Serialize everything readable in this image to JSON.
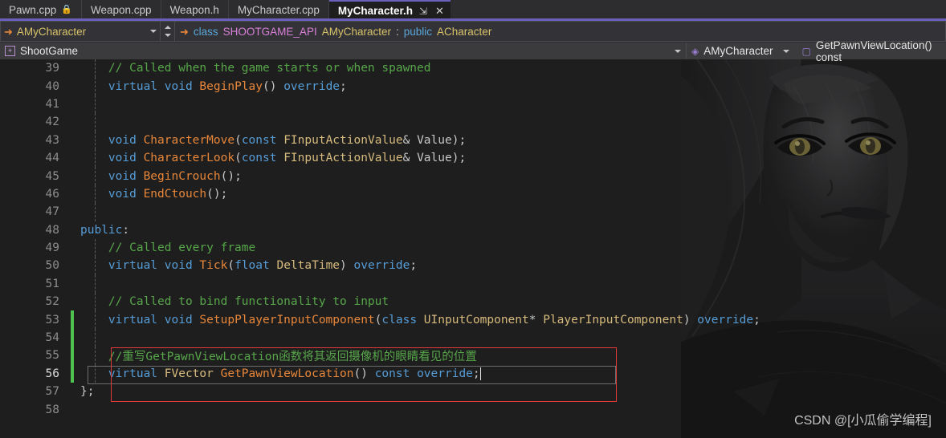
{
  "tabs": [
    {
      "label": "Pawn.cpp",
      "icon": "lock-icon",
      "active": false,
      "pinned": false,
      "closable": false
    },
    {
      "label": "Weapon.cpp",
      "icon": "",
      "active": false,
      "pinned": false,
      "closable": false
    },
    {
      "label": "Weapon.h",
      "icon": "",
      "active": false,
      "pinned": false,
      "closable": false
    },
    {
      "label": "MyCharacter.cpp",
      "icon": "",
      "active": false,
      "pinned": false,
      "closable": false
    },
    {
      "label": "MyCharacter.h",
      "icon": "",
      "active": true,
      "pinned": true,
      "closable": true
    }
  ],
  "tab_icons": {
    "lock": "\u0001f512",
    "pin": "↯",
    "close": "✕"
  },
  "navbar": {
    "class_combo_value": "AMyCharacter",
    "class_combo_icon": "right-arrow-icon",
    "signature_icon": "right-arrow-icon",
    "signature": {
      "kw_class": "class",
      "macro": "SHOOTGAME_API",
      "type": "AMyCharacter",
      "colon": ":",
      "kw_public": "public",
      "base": "ACharacter"
    },
    "project_value": "ShootGame",
    "project_icon": "project-icon",
    "scope_value": "AMyCharacter",
    "scope_icon": "class-icon",
    "member_value": "GetPawnViewLocation() const",
    "member_icon": "method-icon"
  },
  "accent_colors": {
    "tab_underline": "#6a5fbb",
    "annotation_box": "#e03a3a",
    "change_bar": "#4ec14e",
    "comment": "#57a64a",
    "keyword": "#569cd6",
    "type": "#d7ba7d",
    "function": "#e8873a",
    "editor_bg": "#1e1e1e"
  },
  "editor": {
    "current_line": 56,
    "lines": [
      {
        "n": "39",
        "changed": false,
        "indent": true,
        "tokens": [
          {
            "t": "    ",
            "c": "t-plain"
          },
          {
            "t": "// Called when the game starts or when spawned",
            "c": "t-cmt"
          }
        ]
      },
      {
        "n": "40",
        "changed": false,
        "indent": true,
        "tokens": [
          {
            "t": "    ",
            "c": "t-plain"
          },
          {
            "t": "virtual",
            "c": "t-kw"
          },
          {
            "t": " ",
            "c": "t-plain"
          },
          {
            "t": "void",
            "c": "t-kw"
          },
          {
            "t": " ",
            "c": "t-plain"
          },
          {
            "t": "BeginPlay",
            "c": "t-fn"
          },
          {
            "t": "()",
            "c": "t-punc"
          },
          {
            "t": " ",
            "c": "t-plain"
          },
          {
            "t": "override",
            "c": "t-kw"
          },
          {
            "t": ";",
            "c": "t-punc"
          }
        ]
      },
      {
        "n": "41",
        "changed": false,
        "indent": true,
        "tokens": []
      },
      {
        "n": "42",
        "changed": false,
        "indent": true,
        "tokens": []
      },
      {
        "n": "43",
        "changed": false,
        "indent": true,
        "tokens": [
          {
            "t": "    ",
            "c": "t-plain"
          },
          {
            "t": "void",
            "c": "t-kw"
          },
          {
            "t": " ",
            "c": "t-plain"
          },
          {
            "t": "CharacterMove",
            "c": "t-fn"
          },
          {
            "t": "(",
            "c": "t-punc"
          },
          {
            "t": "const",
            "c": "t-kw"
          },
          {
            "t": " ",
            "c": "t-plain"
          },
          {
            "t": "FInputActionValue",
            "c": "t-type"
          },
          {
            "t": "& ",
            "c": "t-punc"
          },
          {
            "t": "Value",
            "c": "t-var"
          },
          {
            "t": ");",
            "c": "t-punc"
          }
        ]
      },
      {
        "n": "44",
        "changed": false,
        "indent": true,
        "tokens": [
          {
            "t": "    ",
            "c": "t-plain"
          },
          {
            "t": "void",
            "c": "t-kw"
          },
          {
            "t": " ",
            "c": "t-plain"
          },
          {
            "t": "CharacterLook",
            "c": "t-fn"
          },
          {
            "t": "(",
            "c": "t-punc"
          },
          {
            "t": "const",
            "c": "t-kw"
          },
          {
            "t": " ",
            "c": "t-plain"
          },
          {
            "t": "FInputActionValue",
            "c": "t-type"
          },
          {
            "t": "& ",
            "c": "t-punc"
          },
          {
            "t": "Value",
            "c": "t-var"
          },
          {
            "t": ");",
            "c": "t-punc"
          }
        ]
      },
      {
        "n": "45",
        "changed": false,
        "indent": true,
        "tokens": [
          {
            "t": "    ",
            "c": "t-plain"
          },
          {
            "t": "void",
            "c": "t-kw"
          },
          {
            "t": " ",
            "c": "t-plain"
          },
          {
            "t": "BeginCrouch",
            "c": "t-fn"
          },
          {
            "t": "();",
            "c": "t-punc"
          }
        ]
      },
      {
        "n": "46",
        "changed": false,
        "indent": true,
        "tokens": [
          {
            "t": "    ",
            "c": "t-plain"
          },
          {
            "t": "void",
            "c": "t-kw"
          },
          {
            "t": " ",
            "c": "t-plain"
          },
          {
            "t": "EndCtouch",
            "c": "t-fn"
          },
          {
            "t": "();",
            "c": "t-punc"
          }
        ]
      },
      {
        "n": "47",
        "changed": false,
        "indent": true,
        "tokens": []
      },
      {
        "n": "48",
        "changed": false,
        "indent": false,
        "tokens": [
          {
            "t": "public",
            "c": "t-kw"
          },
          {
            "t": ":",
            "c": "t-punc"
          }
        ]
      },
      {
        "n": "49",
        "changed": false,
        "indent": true,
        "tokens": [
          {
            "t": "    ",
            "c": "t-plain"
          },
          {
            "t": "// Called every frame",
            "c": "t-cmt"
          }
        ]
      },
      {
        "n": "50",
        "changed": false,
        "indent": true,
        "tokens": [
          {
            "t": "    ",
            "c": "t-plain"
          },
          {
            "t": "virtual",
            "c": "t-kw"
          },
          {
            "t": " ",
            "c": "t-plain"
          },
          {
            "t": "void",
            "c": "t-kw"
          },
          {
            "t": " ",
            "c": "t-plain"
          },
          {
            "t": "Tick",
            "c": "t-fn"
          },
          {
            "t": "(",
            "c": "t-punc"
          },
          {
            "t": "float",
            "c": "t-kw"
          },
          {
            "t": " ",
            "c": "t-plain"
          },
          {
            "t": "DeltaTime",
            "c": "t-type"
          },
          {
            "t": ") ",
            "c": "t-punc"
          },
          {
            "t": "override",
            "c": "t-kw"
          },
          {
            "t": ";",
            "c": "t-punc"
          }
        ]
      },
      {
        "n": "51",
        "changed": false,
        "indent": true,
        "tokens": []
      },
      {
        "n": "52",
        "changed": false,
        "indent": true,
        "tokens": [
          {
            "t": "    ",
            "c": "t-plain"
          },
          {
            "t": "// Called to bind functionality to input",
            "c": "t-cmt"
          }
        ]
      },
      {
        "n": "53",
        "changed": true,
        "indent": true,
        "tokens": [
          {
            "t": "    ",
            "c": "t-plain"
          },
          {
            "t": "virtual",
            "c": "t-kw"
          },
          {
            "t": " ",
            "c": "t-plain"
          },
          {
            "t": "void",
            "c": "t-kw"
          },
          {
            "t": " ",
            "c": "t-plain"
          },
          {
            "t": "SetupPlayerInputComponent",
            "c": "t-fn"
          },
          {
            "t": "(",
            "c": "t-punc"
          },
          {
            "t": "class",
            "c": "t-kw"
          },
          {
            "t": " ",
            "c": "t-plain"
          },
          {
            "t": "UInputComponent",
            "c": "t-type"
          },
          {
            "t": "* ",
            "c": "t-punc"
          },
          {
            "t": "PlayerInputComponent",
            "c": "t-type"
          },
          {
            "t": ") ",
            "c": "t-punc"
          },
          {
            "t": "override",
            "c": "t-kw"
          },
          {
            "t": ";",
            "c": "t-punc"
          }
        ]
      },
      {
        "n": "54",
        "changed": true,
        "indent": true,
        "tokens": []
      },
      {
        "n": "55",
        "changed": true,
        "indent": true,
        "tokens": [
          {
            "t": "    ",
            "c": "t-plain"
          },
          {
            "t": "//重写GetPawnViewLocation函数将其返回摄像机的眼睛看见的位置",
            "c": "t-cmt"
          }
        ]
      },
      {
        "n": "56",
        "changed": true,
        "indent": true,
        "current": true,
        "tokens": [
          {
            "t": "    ",
            "c": "t-plain"
          },
          {
            "t": "virtual",
            "c": "t-kw"
          },
          {
            "t": " ",
            "c": "t-plain"
          },
          {
            "t": "FVector",
            "c": "t-type"
          },
          {
            "t": " ",
            "c": "t-plain"
          },
          {
            "t": "GetPawnViewLocation",
            "c": "t-fn"
          },
          {
            "t": "()",
            "c": "t-punc"
          },
          {
            "t": " ",
            "c": "t-plain"
          },
          {
            "t": "const",
            "c": "t-kw"
          },
          {
            "t": " ",
            "c": "t-plain"
          },
          {
            "t": "override",
            "c": "t-kw"
          },
          {
            "t": ";",
            "c": "t-punc"
          }
        ]
      },
      {
        "n": "57",
        "changed": false,
        "indent": false,
        "tokens": [
          {
            "t": "};",
            "c": "t-punc"
          }
        ]
      },
      {
        "n": "58",
        "changed": false,
        "indent": false,
        "tokens": []
      }
    ]
  },
  "watermark": "CSDN @[小瓜偷学编程]"
}
